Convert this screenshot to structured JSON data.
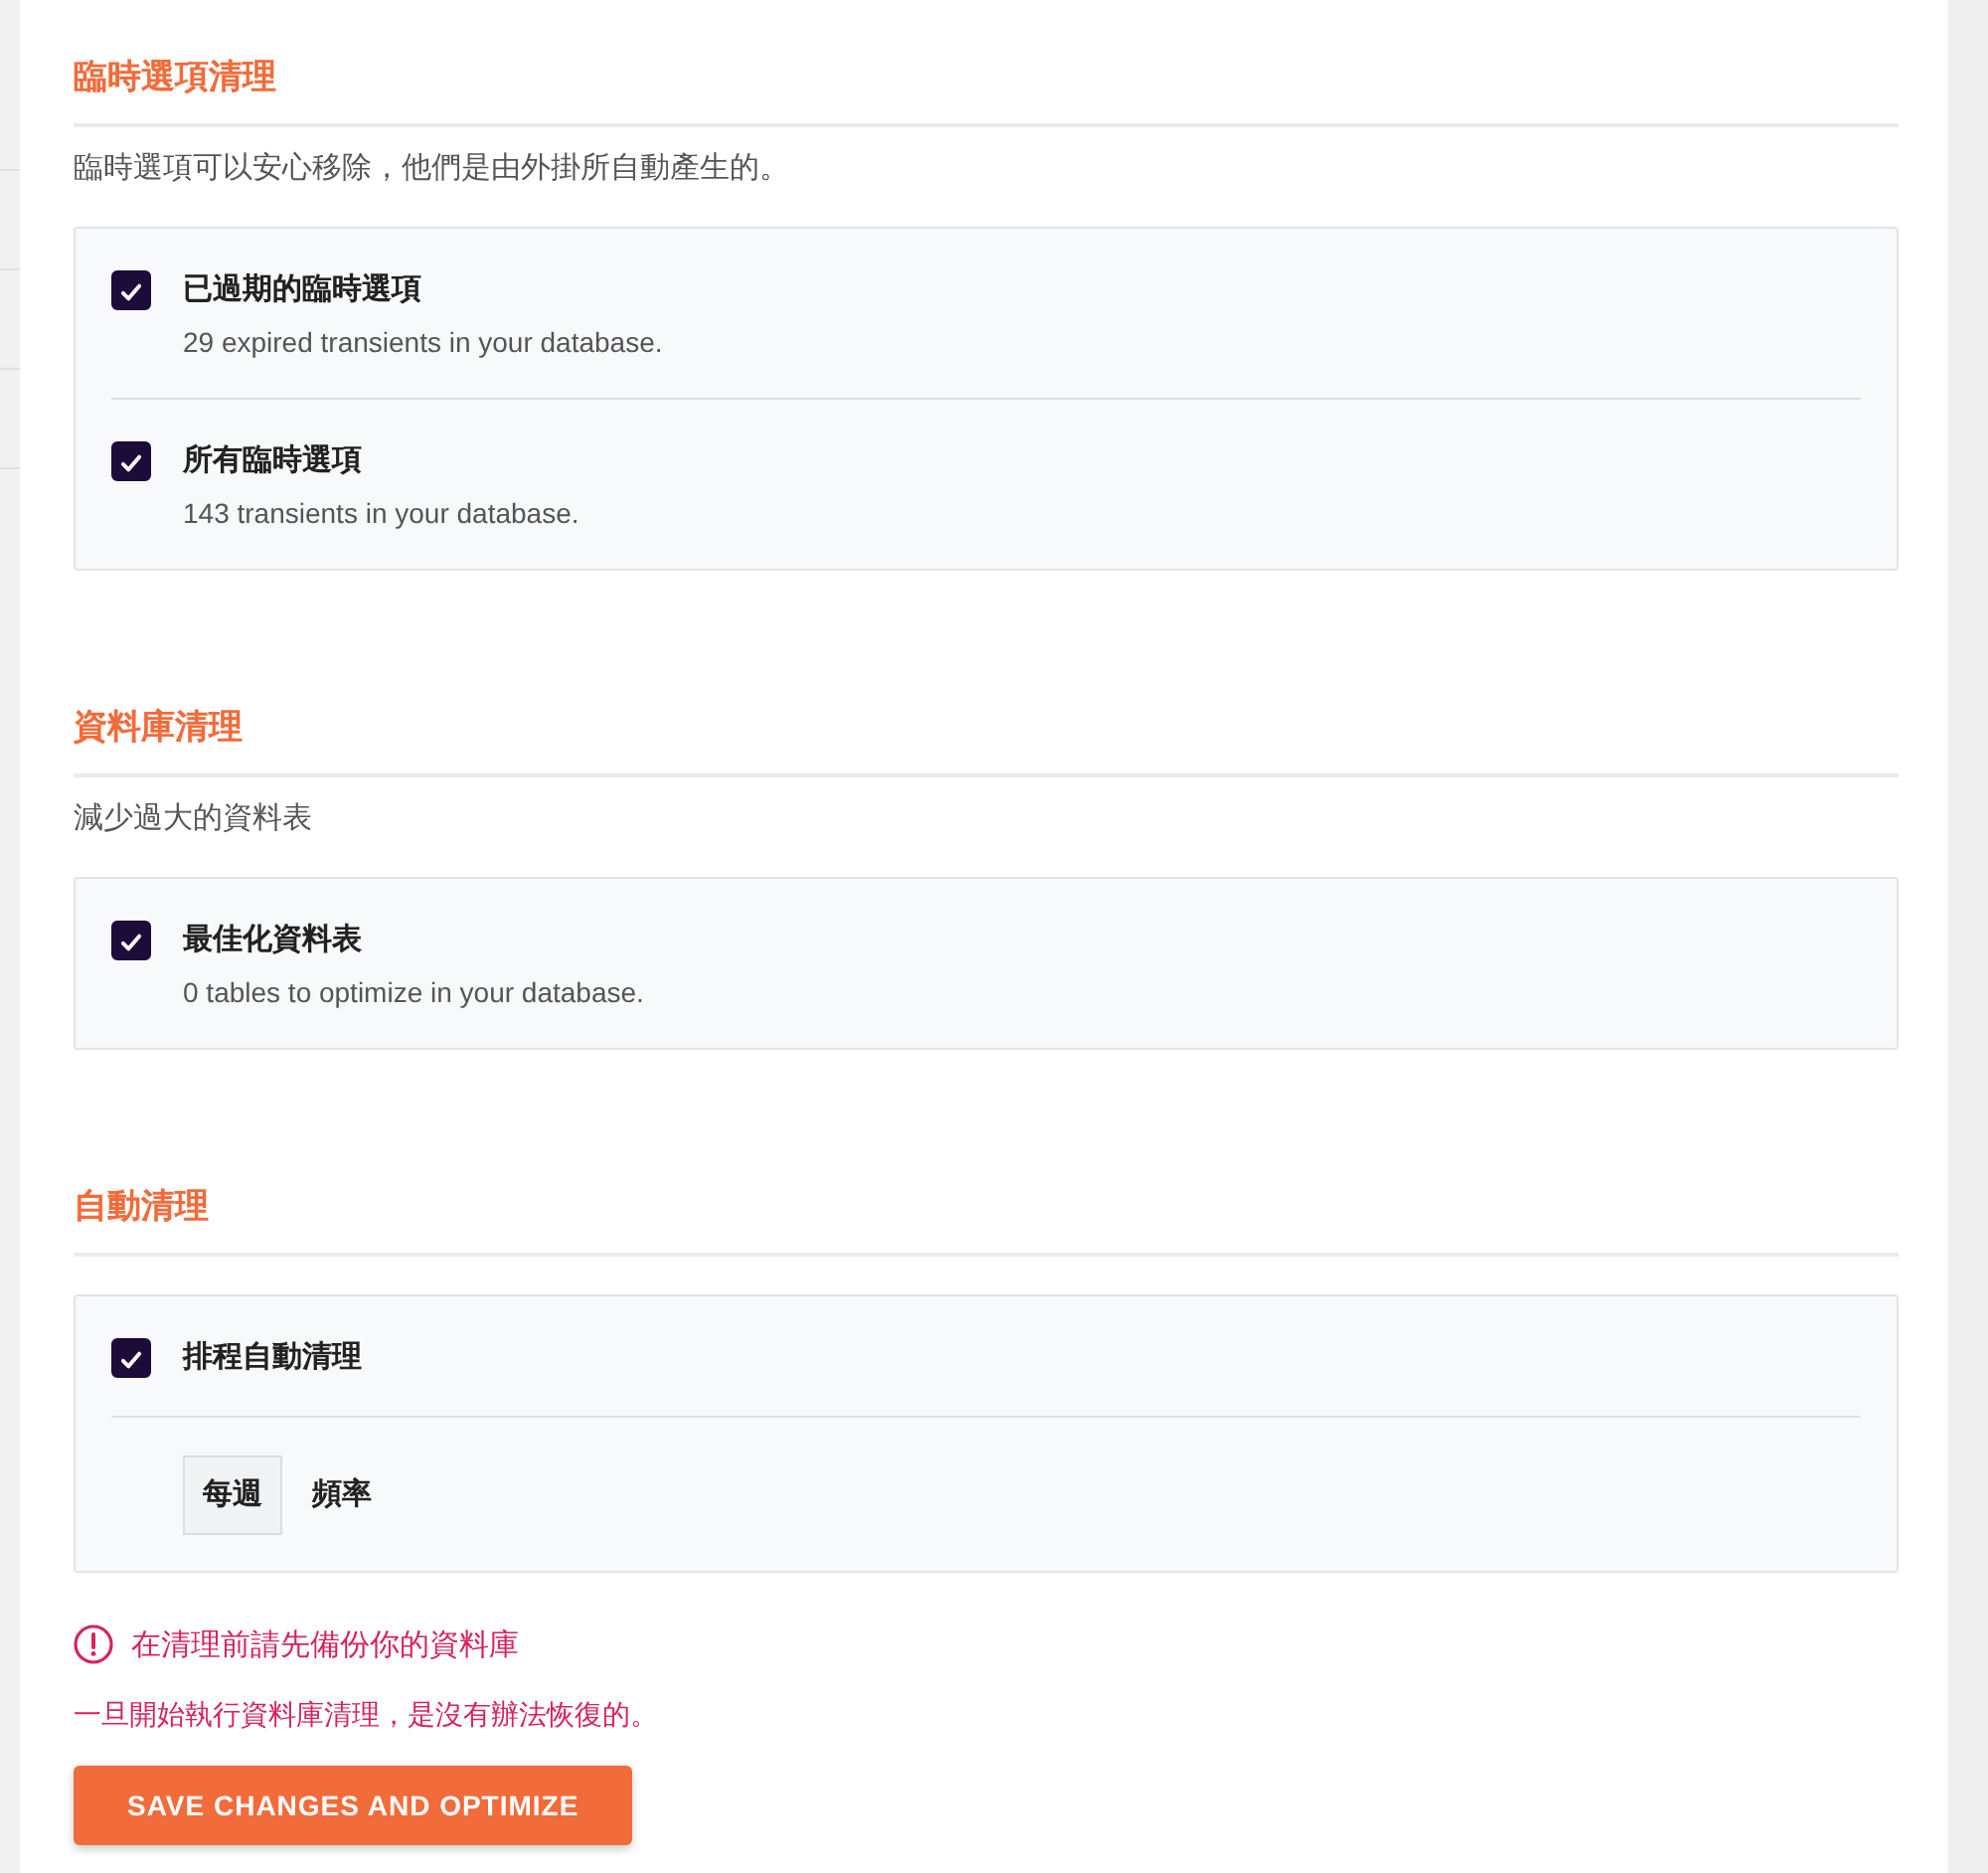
{
  "sections": [
    {
      "title": "臨時選項清理",
      "description": "臨時選項可以安心移除，他們是由外掛所自動產生的。",
      "items": [
        {
          "kind": "checkbox",
          "label": "已過期的臨時選項",
          "detail": "29 expired transients in your database.",
          "checked": true
        },
        {
          "kind": "checkbox",
          "label": "所有臨時選項",
          "detail": "143 transients in your database.",
          "checked": true
        }
      ]
    },
    {
      "title": "資料庫清理",
      "description": "減少過大的資料表",
      "items": [
        {
          "kind": "checkbox",
          "label": "最佳化資料表",
          "detail": "0 tables to optimize in your database.",
          "checked": true
        }
      ]
    },
    {
      "title": "自動清理",
      "items": [
        {
          "kind": "checkbox",
          "label": "排程自動清理",
          "checked": true
        },
        {
          "kind": "select",
          "value": "每週",
          "label": "頻率"
        }
      ]
    }
  ],
  "warning": {
    "title": "在清理前請先備份你的資料庫",
    "text": "一旦開始執行資料庫清理，是沒有辦法恢復的。"
  },
  "button": {
    "label": "SAVE CHANGES AND OPTIMIZE"
  }
}
